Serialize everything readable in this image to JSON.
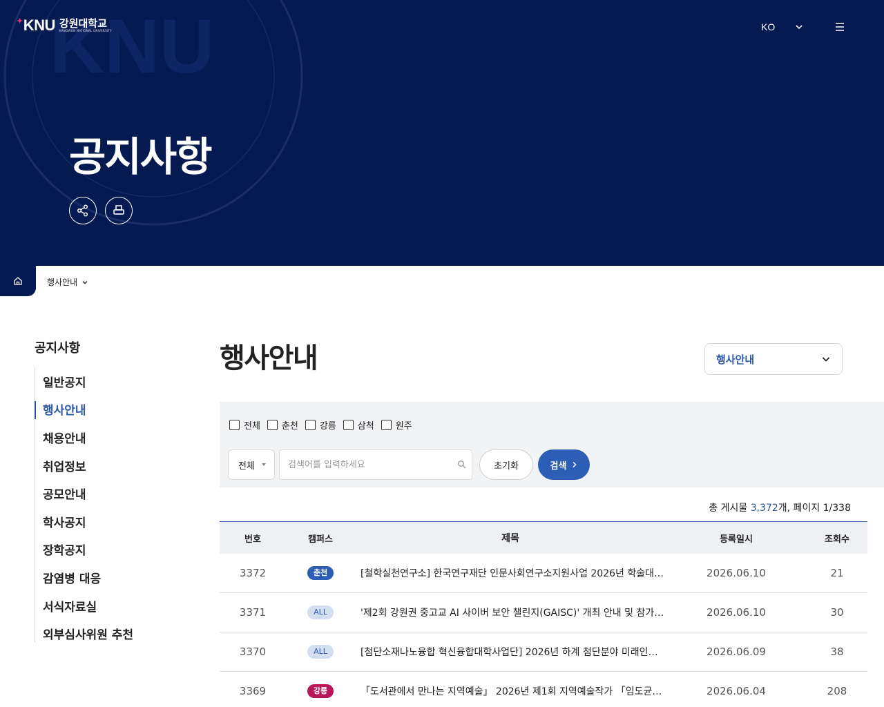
{
  "header": {
    "logo_mark": "KNU",
    "logo_kr": "강원대학교",
    "logo_en": "KANGWON NATIONAL UNIVERSITY",
    "lang": "KO",
    "hero_title": "공지사항"
  },
  "breadcrumb": {
    "current": "행사안내"
  },
  "sidebar": {
    "title": "공지사항",
    "items": [
      {
        "label": "일반공지",
        "active": false
      },
      {
        "label": "행사안내",
        "active": true
      },
      {
        "label": "채용안내",
        "active": false
      },
      {
        "label": "취업정보",
        "active": false
      },
      {
        "label": "공모안내",
        "active": false
      },
      {
        "label": "학사공지",
        "active": false
      },
      {
        "label": "장학공지",
        "active": false
      },
      {
        "label": "감염병 대응",
        "active": false
      },
      {
        "label": "서식자료실",
        "active": false
      },
      {
        "label": "외부심사위원 추천",
        "active": false
      }
    ]
  },
  "main": {
    "title": "행사안내",
    "category_select": "행사안내"
  },
  "filters": {
    "campuses": [
      "전체",
      "춘천",
      "강릉",
      "삼척",
      "원주"
    ],
    "scope": "전체",
    "search_placeholder": "검색어를 입력하세요",
    "reset_label": "초기화",
    "search_label": "검색"
  },
  "summary": {
    "prefix": "총 게시물 ",
    "total": "3,372",
    "suffix": "개, 페이지 1/338"
  },
  "table": {
    "columns": [
      "번호",
      "캠퍼스",
      "제목",
      "등록일시",
      "조회수"
    ],
    "rows": [
      {
        "no": "3372",
        "campus": "춘천",
        "campus_style": "chuncheon",
        "title": "[철학실천연구소] 한국연구재단 인문사회연구소지원사업 2026년 학술대회 개최 안내",
        "date": "2026.06.10",
        "views": "21"
      },
      {
        "no": "3371",
        "campus": "ALL",
        "campus_style": "all",
        "title": "'제2회 강원권 중고교 AI 사이버 보안 챌린지(GAISC)' 개최 안내 및 참가자 모집",
        "date": "2026.06.10",
        "views": "30"
      },
      {
        "no": "3370",
        "campus": "ALL",
        "campus_style": "all",
        "title": "[첨단소재나노융합 혁신융합대학사업단] 2026년 하계 첨단분야 미래인재 양성 프로그램 안내",
        "date": "2026.06.09",
        "views": "38"
      },
      {
        "no": "3369",
        "campus": "강릉",
        "campus_style": "gangneung",
        "title": "「도서관에서 만나는 지역예술」 2026년 제1회 지역예술작가 「임도균」 초대전 안내",
        "date": "2026.06.04",
        "views": "208"
      }
    ]
  },
  "colors": {
    "navy": "#061a52",
    "accent": "#2d58a8",
    "badge_chuncheon": "#2b5eb4",
    "badge_all_bg": "#d3dff1",
    "badge_gangneung": "#b8155a"
  },
  "icons": [
    "chevron-down-icon",
    "menu-icon",
    "share-icon",
    "print-icon",
    "home-icon",
    "search-icon",
    "chevron-right-icon"
  ]
}
